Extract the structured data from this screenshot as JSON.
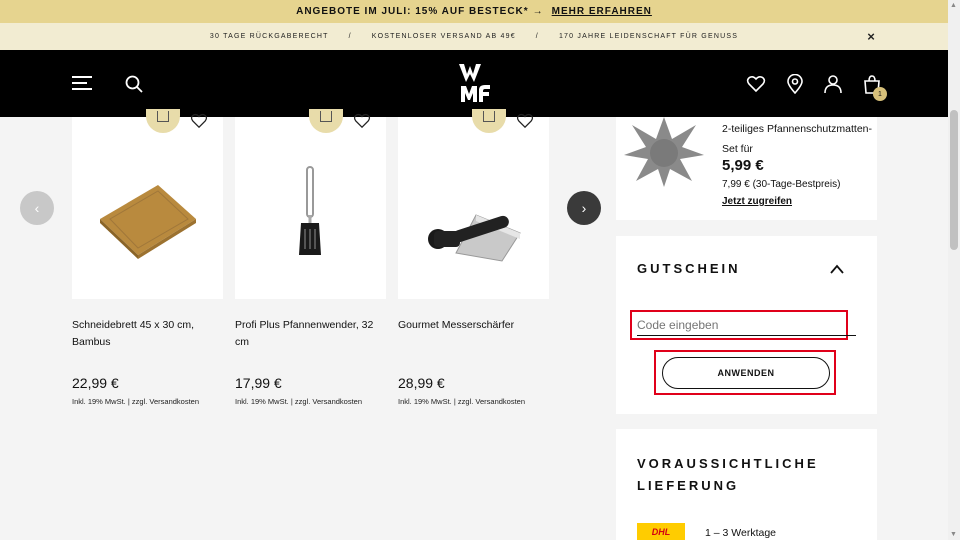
{
  "promo": {
    "text": "ANGEBOTE IM JULI: 15% AUF BESTECK*",
    "arrow": "→",
    "link": "MEHR ERFAHREN"
  },
  "usp": {
    "items": [
      "30 TAGE RÜCKGABERECHT",
      "KOSTENLOSER VERSAND AB 49€",
      "170 JAHRE LEIDENSCHAFT FÜR GENUSS"
    ],
    "separator": "/",
    "close": "×"
  },
  "header": {
    "logo": "WMF",
    "cart_count": "1"
  },
  "carousel": {
    "prev": "‹",
    "next": "›",
    "products": [
      {
        "name": "Schneidebrett 45 x 30 cm, Bambus",
        "price": "22,99 €",
        "tax": "Inkl. 19% MwSt. | zzgl. Versandkosten"
      },
      {
        "name": "Profi Plus Pfannenwender, 32 cm",
        "price": "17,99 €",
        "tax": "Inkl. 19% MwSt. | zzgl. Versandkosten"
      },
      {
        "name": "Gourmet Messerschärfer",
        "price": "28,99 €",
        "tax": "Inkl. 19% MwSt. | zzgl. Versandkosten"
      }
    ]
  },
  "promo_item": {
    "title": "2-teiliges Pfannenschutzmatten-Set für",
    "price": "5,99 €",
    "old_price": "7,99 € (30-Tage-Bestpreis)",
    "link": "Jetzt zugreifen"
  },
  "voucher": {
    "title": "GUTSCHEIN",
    "placeholder": "Code eingeben",
    "button": "ANWENDEN"
  },
  "delivery": {
    "title": "VORAUSSICHTLICHE LIEFERUNG",
    "carrier": "DHL",
    "days": "1 – 3 Werktage"
  },
  "colors": {
    "promo_bg": "#e6d48f",
    "usp_bg": "#f2ecd2",
    "header_bg": "#000000",
    "highlight": "#e0001a",
    "accent": "#d7c07a"
  }
}
